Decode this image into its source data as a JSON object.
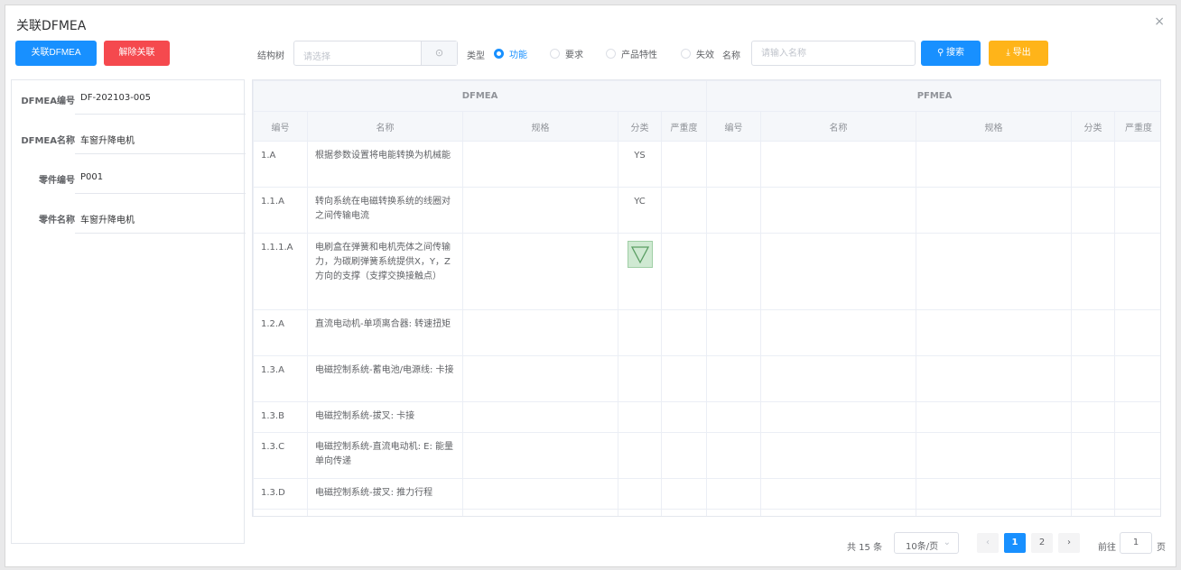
{
  "dialog": {
    "title": "关联DFMEA",
    "close_glyph": "×"
  },
  "toolbar": {
    "link_label": "关联DFMEA",
    "unlink_label": "解除关联",
    "tree_label": "结构树",
    "tree_placeholder": "请选择",
    "type_label": "类型",
    "types": [
      "功能",
      "要求",
      "产品特性",
      "失效"
    ],
    "type_selected": "功能",
    "name_label": "名称",
    "name_placeholder": "请输入名称",
    "search_label": "搜索",
    "export_label": "导出"
  },
  "info": [
    {
      "key": "DFMEA编号",
      "value": "DF-202103-005"
    },
    {
      "key": "DFMEA名称",
      "value": "车窗升降电机"
    },
    {
      "key": "零件编号",
      "value": "P001"
    },
    {
      "key": "零件名称",
      "value": "车窗升降电机"
    }
  ],
  "table": {
    "groups": [
      "DFMEA",
      "PFMEA"
    ],
    "columns": [
      "编号",
      "名称",
      "规格",
      "分类",
      "严重度",
      "编号",
      "名称",
      "规格",
      "分类",
      "严重度"
    ],
    "rows": [
      {
        "code": "1.A",
        "name": "根据参数设置将电能转换为机械能",
        "cat": "YS"
      },
      {
        "code": "1.1.A",
        "name": "转向系统在电磁转换系统的线圈对之间传输电流",
        "cat": "YC"
      },
      {
        "code": "1.1.1.A",
        "name": "电刷盒在弹簧和电机壳体之间传输力，为碳刷弹簧系统提供X，Y，Z方向的支撑（支撑交换接触点）",
        "cat": "",
        "cat_icon": "triangle-down-icon"
      },
      {
        "code": "1.2.A",
        "name": "直流电动机-单项离合器: 转速扭矩",
        "cat": ""
      },
      {
        "code": "1.3.A",
        "name": "电磁控制系统-蓄电池/电源线: 卡接",
        "cat": ""
      },
      {
        "code": "1.3.B",
        "name": "电磁控制系统-拔叉: 卡接",
        "cat": ""
      },
      {
        "code": "1.3.C",
        "name": "电磁控制系统-直流电动机: E: 能量单向传递",
        "cat": ""
      },
      {
        "code": "1.3.D",
        "name": "电磁控制系统-拔叉: 推力行程",
        "cat": ""
      }
    ]
  },
  "pager": {
    "total": "共 15 条",
    "size": "10条/页",
    "prev": "‹",
    "pages": [
      "1",
      "2"
    ],
    "current": "1",
    "next": "›",
    "goto_prefix": "前往",
    "goto_value": "1",
    "goto_suffix": "页"
  }
}
